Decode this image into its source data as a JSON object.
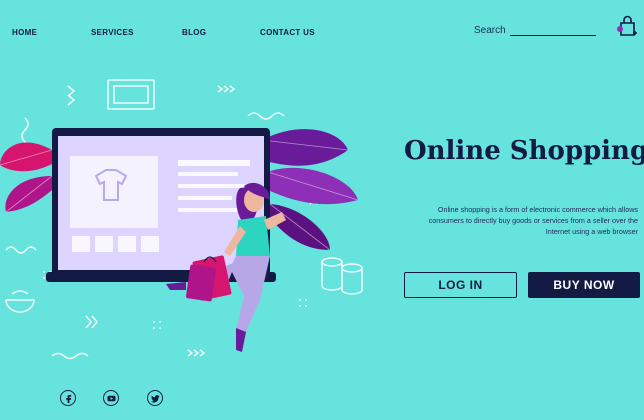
{
  "nav": {
    "items": [
      "HOME",
      "SERVICES",
      "BLOG",
      "CONTACT US"
    ]
  },
  "search": {
    "label": "Search"
  },
  "hero": {
    "title": "Online Shopping",
    "description": "Online shopping is a form of electronic commerce which allows consumers to directly buy goods or services from a seller over the Internet using a web browser",
    "login_label": "LOG IN",
    "buy_label": "BUY NOW"
  },
  "icons": {
    "cart": "shopping-bag-icon",
    "social": [
      "facebook-icon",
      "youtube-icon",
      "twitter-icon"
    ]
  },
  "colors": {
    "background": "#66e3dd",
    "navy": "#131a44",
    "purple": "#6a1b9a",
    "magenta": "#d6156f",
    "lavender": "#ddd4ff",
    "skin_shirt": "#2dd4bf"
  }
}
